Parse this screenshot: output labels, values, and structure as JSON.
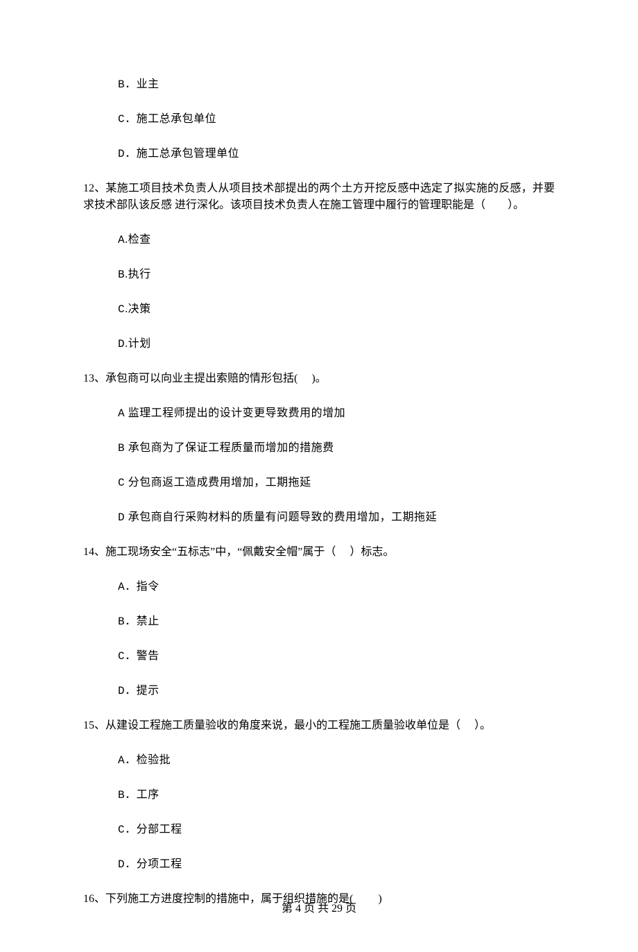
{
  "q11_options": {
    "B": {
      "letter": "B",
      "sep": "．",
      "text": "业主"
    },
    "C": {
      "letter": "C",
      "sep": "．",
      "text": "施工总承包单位"
    },
    "D": {
      "letter": "D",
      "sep": "．",
      "text": "施工总承包管理单位"
    }
  },
  "q12": {
    "prompt": "12、某施工项目技术负责人从项目技术部提出的两个土方开挖反感中选定了拟实施的反感，并要求技术部队该反感 进行深化。该项目技术负责人在施工管理中履行的管理职能是（　　）。",
    "options": {
      "A": {
        "letter": "A",
        "sep": ".",
        "text": "检查"
      },
      "B": {
        "letter": "B",
        "sep": ".",
        "text": "执行"
      },
      "C": {
        "letter": "C",
        "sep": ".",
        "text": "决策"
      },
      "D": {
        "letter": "D",
        "sep": ".",
        "text": "计划"
      }
    }
  },
  "q13": {
    "prompt": "13、承包商可以向业主提出索赔的情形包括(　 )。",
    "options": {
      "A": {
        "letter": "A",
        "sep": " ",
        "text": "监理工程师提出的设计变更导致费用的增加"
      },
      "B": {
        "letter": "B",
        "sep": " ",
        "text": "承包商为了保证工程质量而增加的措施费"
      },
      "C": {
        "letter": "C",
        "sep": " ",
        "text": "分包商返工造成费用增加，工期拖延"
      },
      "D": {
        "letter": "D",
        "sep": " ",
        "text": "承包商自行采购材料的质量有问题导致的费用增加，工期拖延"
      }
    }
  },
  "q14": {
    "prompt": "14、施工现场安全“五标志”中，“佩戴安全帽”属于（　 ）标志。",
    "options": {
      "A": {
        "letter": "A",
        "sep": "．",
        "text": "指令"
      },
      "B": {
        "letter": "B",
        "sep": "．",
        "text": "禁止"
      },
      "C": {
        "letter": "C",
        "sep": "．",
        "text": "警告"
      },
      "D": {
        "letter": "D",
        "sep": "．",
        "text": "提示"
      }
    }
  },
  "q15": {
    "prompt": "15、从建设工程施工质量验收的角度来说，最小的工程施工质量验收单位是（　 ）。",
    "options": {
      "A": {
        "letter": "A",
        "sep": "．",
        "text": "检验批"
      },
      "B": {
        "letter": "B",
        "sep": "．",
        "text": "工序"
      },
      "C": {
        "letter": "C",
        "sep": "．",
        "text": "分部工程"
      },
      "D": {
        "letter": "D",
        "sep": "．",
        "text": "分项工程"
      }
    }
  },
  "q16": {
    "prompt": "16、下列施工方进度控制的措施中，属于组织措施的是(　　 )"
  },
  "footer": "第 4 页 共 29 页"
}
